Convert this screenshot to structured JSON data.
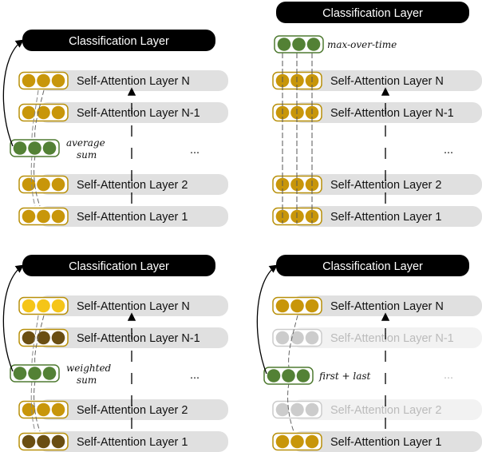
{
  "colors": {
    "gold": "#C8960A",
    "gold_border": "#B8900A",
    "bright": "#F5C518",
    "dark": "#6A4E12",
    "green": "#538135",
    "green_border": "#4E7A30",
    "grey_bar": "#E0E0E0",
    "faded_bar": "#F2F2F2",
    "faded_dot": "#CCCCCC",
    "black": "#000000"
  },
  "panels": [
    {
      "title": "Classification Layer",
      "pool_label": [
        "average",
        "sum"
      ],
      "ellipsis": "...",
      "layers": [
        {
          "label": "Self-Attention Layer N",
          "dot": "gold"
        },
        {
          "label": "Self-Attention Layer N-1",
          "dot": "gold"
        },
        {
          "label": "Self-Attention Layer 2",
          "dot": "gold"
        },
        {
          "label": "Self-Attention Layer 1",
          "dot": "gold"
        }
      ]
    },
    {
      "title": "Classification Layer",
      "pool_label": [
        "max-over-time"
      ],
      "ellipsis": "...",
      "layers": [
        {
          "label": "Self-Attention Layer N",
          "dot": "gold"
        },
        {
          "label": "Self-Attention Layer N-1",
          "dot": "gold"
        },
        {
          "label": "Self-Attention Layer 2",
          "dot": "gold"
        },
        {
          "label": "Self-Attention Layer 1",
          "dot": "gold"
        }
      ]
    },
    {
      "title": "Classification Layer",
      "pool_label": [
        "weighted",
        "sum"
      ],
      "ellipsis": "...",
      "layers": [
        {
          "label": "Self-Attention Layer N",
          "dot": "bright"
        },
        {
          "label": "Self-Attention Layer N-1",
          "dot": "dark"
        },
        {
          "label": "Self-Attention Layer 2",
          "dot": "gold"
        },
        {
          "label": "Self-Attention Layer 1",
          "dot": "dark"
        }
      ]
    },
    {
      "title": "Classification Layer",
      "pool_label": [
        "first + last"
      ],
      "ellipsis": "...",
      "layers": [
        {
          "label": "Self-Attention Layer N",
          "dot": "gold"
        },
        {
          "label": "Self-Attention Layer N-1",
          "dot": "faded"
        },
        {
          "label": "Self-Attention Layer 2",
          "dot": "faded"
        },
        {
          "label": "Self-Attention Layer 1",
          "dot": "gold"
        }
      ]
    }
  ]
}
